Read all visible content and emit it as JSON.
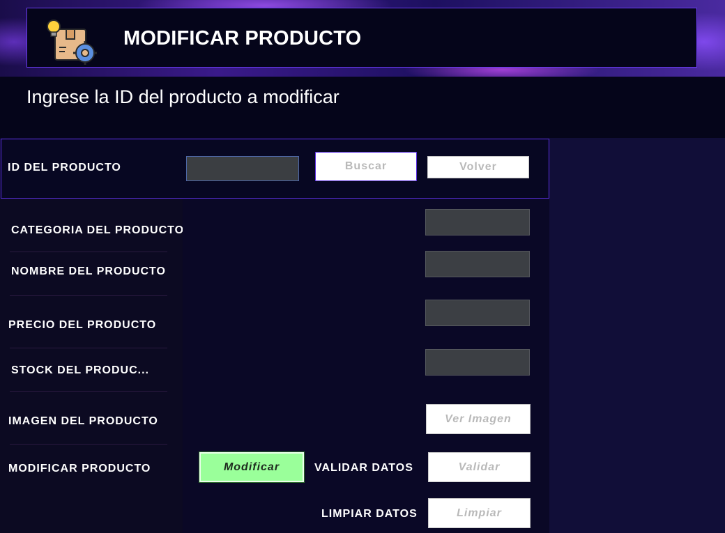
{
  "header": {
    "title": "MODIFICAR PRODUCTO",
    "icon": "product-settings-icon"
  },
  "subtitle": "Ingrese la ID del producto a modificar",
  "search": {
    "label": "ID DEL PRODUCTO",
    "input_value": "",
    "search_button": "Buscar",
    "back_button": "Volver"
  },
  "form": {
    "category_label": "CATEGORIA DEL PRODUCTO",
    "name_label": "NOMBRE DEL PRODUCTO",
    "price_label": "PRECIO DEL PRODUCTO",
    "stock_label": "STOCK DEL PRODUC...",
    "image_label": "IMAGEN DEL PRODUCTO",
    "image_button": "Ver Imagen",
    "modify_label": "MODIFICAR PRODUCTO",
    "modify_button": "Modificar",
    "validate_label": "VALIDAR DATOS",
    "validate_button": "Validar",
    "clear_label": "LIMPIAR DATOS",
    "clear_button": "Limpiar",
    "category_value": "",
    "name_value": "",
    "price_value": "",
    "stock_value": ""
  },
  "colors": {
    "accent_border": "#5b30e0",
    "modify_button_bg": "#9aff9a",
    "field_bg": "#3c3f44"
  }
}
